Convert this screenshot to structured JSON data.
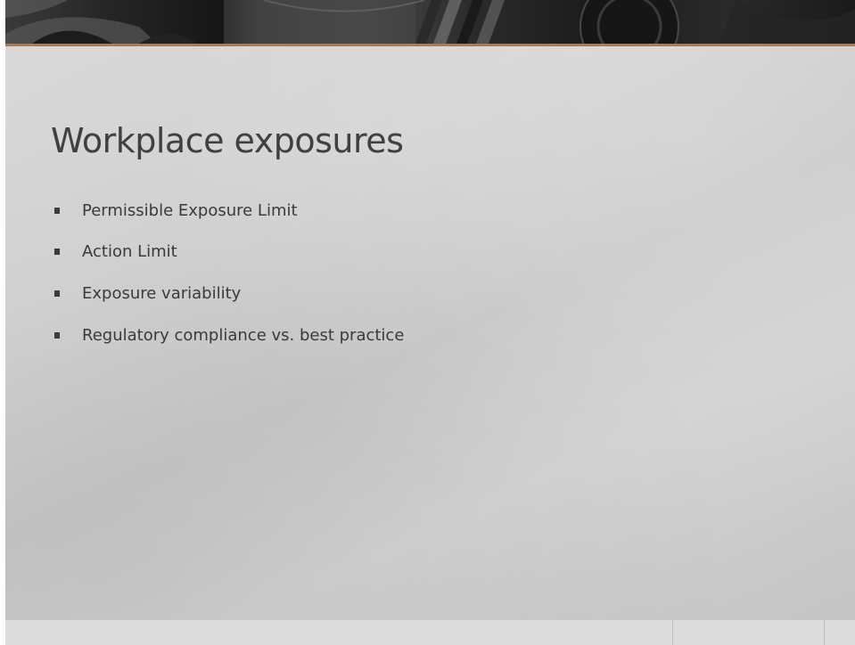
{
  "slide": {
    "title": "Workplace exposures",
    "bullets": [
      "Permissible Exposure Limit",
      "Action Limit",
      "Exposure variability",
      "Regulatory compliance vs. best practice"
    ],
    "footer": {
      "left": "",
      "date": "",
      "page_number": ""
    }
  },
  "theme": {
    "accent_color": "#c0733a",
    "banner_color": "#1f1f1f",
    "title_color": "#404040",
    "text_color": "#3a3a3a"
  }
}
